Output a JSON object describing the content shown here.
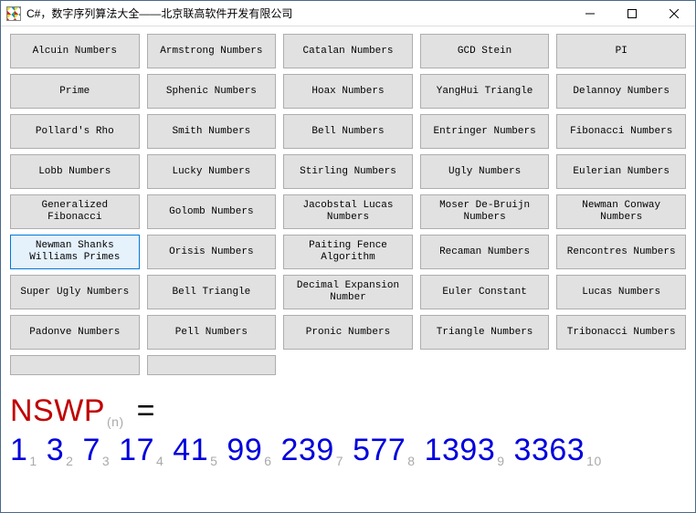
{
  "window": {
    "title": "C#，数字序列算法大全——北京联高软件开发有限公司"
  },
  "buttons": [
    {
      "label": "Alcuin Numbers",
      "selected": false
    },
    {
      "label": "Armstrong Numbers",
      "selected": false
    },
    {
      "label": "Catalan Numbers",
      "selected": false
    },
    {
      "label": "GCD Stein",
      "selected": false
    },
    {
      "label": "PI",
      "selected": false
    },
    {
      "label": "Prime",
      "selected": false
    },
    {
      "label": "Sphenic Numbers",
      "selected": false
    },
    {
      "label": "Hoax Numbers",
      "selected": false
    },
    {
      "label": "YangHui Triangle",
      "selected": false
    },
    {
      "label": "Delannoy Numbers",
      "selected": false
    },
    {
      "label": "Pollard's Rho",
      "selected": false
    },
    {
      "label": "Smith Numbers",
      "selected": false
    },
    {
      "label": "Bell Numbers",
      "selected": false
    },
    {
      "label": "Entringer Numbers",
      "selected": false
    },
    {
      "label": "Fibonacci Numbers",
      "selected": false
    },
    {
      "label": "Lobb Numbers",
      "selected": false
    },
    {
      "label": "Lucky Numbers",
      "selected": false
    },
    {
      "label": "Stirling Numbers",
      "selected": false
    },
    {
      "label": "Ugly Numbers",
      "selected": false
    },
    {
      "label": "Eulerian Numbers",
      "selected": false
    },
    {
      "label": "Generalized Fibonacci",
      "selected": false
    },
    {
      "label": "Golomb Numbers",
      "selected": false
    },
    {
      "label": "Jacobstal Lucas Numbers",
      "selected": false
    },
    {
      "label": "Moser De-Bruijn Numbers",
      "selected": false
    },
    {
      "label": "Newman Conway Numbers",
      "selected": false
    },
    {
      "label": "Newman Shanks Williams Primes",
      "selected": true
    },
    {
      "label": "Orisis Numbers",
      "selected": false
    },
    {
      "label": "Paiting Fence Algorithm",
      "selected": false
    },
    {
      "label": "Recaman Numbers",
      "selected": false
    },
    {
      "label": "Rencontres Numbers",
      "selected": false
    },
    {
      "label": "Super Ugly Numbers",
      "selected": false
    },
    {
      "label": "Bell Triangle",
      "selected": false
    },
    {
      "label": "Decimal Expansion Number",
      "selected": false
    },
    {
      "label": "Euler Constant",
      "selected": false
    },
    {
      "label": "Lucas Numbers",
      "selected": false
    },
    {
      "label": "Padonve Numbers",
      "selected": false
    },
    {
      "label": "Pell Numbers",
      "selected": false
    },
    {
      "label": "Pronic Numbers",
      "selected": false
    },
    {
      "label": "Triangle Numbers",
      "selected": false
    },
    {
      "label": "Tribonacci Numbers",
      "selected": false
    }
  ],
  "output": {
    "name": "NSWP",
    "sub": "(n)",
    "eq": "=",
    "terms": [
      "1",
      "3",
      "7",
      "17",
      "41",
      "99",
      "239",
      "577",
      "1393",
      "3363"
    ],
    "indices": [
      "1",
      "2",
      "3",
      "4",
      "5",
      "6",
      "7",
      "8",
      "9",
      "10"
    ]
  }
}
